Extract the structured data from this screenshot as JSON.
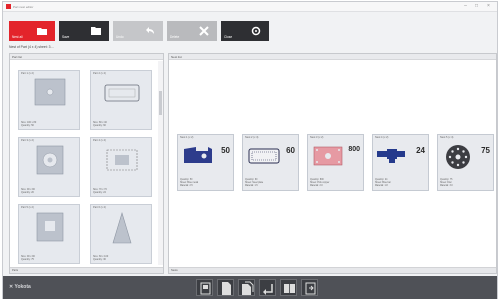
{
  "window": {
    "title": "Part nest editor"
  },
  "toolbar": {
    "buttons": [
      {
        "label": "Nest all",
        "icon": "folder-open-icon",
        "color": "#e3242b"
      },
      {
        "label": "Save",
        "icon": "folder-icon",
        "color": "#2e2f33"
      },
      {
        "label": "Undo",
        "icon": "undo-icon",
        "color": "#c5c6c9"
      },
      {
        "label": "Delete",
        "icon": "close-icon",
        "color": "#b9babd"
      },
      {
        "label": "Close",
        "icon": "settings-icon",
        "color": "#2e2f33"
      }
    ]
  },
  "path": "Nest of Part (4 x 4) sheet: 3 ...",
  "left_panel": {
    "title": "Part list",
    "thumbs": [
      {
        "title": "Part 1 (x 2)",
        "info": [
          "Size: 100 x 80",
          "Quantity: 50"
        ]
      },
      {
        "title": "Part 2 (x 4)",
        "info": [
          "Size: 80 x 40",
          "Quantity: 60"
        ]
      },
      {
        "title": "Part 3 (x 2)",
        "info": [
          "Size: 90 x 90",
          "Quantity: 20"
        ]
      },
      {
        "title": "Part 4 (x 4)",
        "info": [
          "Size: 70 x 70",
          "Quantity: 24"
        ]
      },
      {
        "title": "Part 5 (x 2)",
        "info": [
          "Size: 90 x 90",
          "Quantity: 75"
        ]
      },
      {
        "title": "Part 6 (x 4)",
        "info": [
          "Size: 60 x 100",
          "Quantity: 30"
        ]
      }
    ],
    "scroll_label": "Parts"
  },
  "right_panel": {
    "title": "Nest list",
    "cards": [
      {
        "title": "Nest 1 (x 2)",
        "count": "50",
        "info": [
          "Quantity: 50",
          "Sheet: Blue metal",
          "Material: 2.5"
        ],
        "shape_color": "#2d3c8c"
      },
      {
        "title": "Nest 2 (x 4)",
        "count": "60",
        "info": [
          "Quantity: 60",
          "Sheet: Steel plate",
          "Material: 1.5"
        ],
        "shape_color": "#2a2f52"
      },
      {
        "title": "Nest 3 (x 2)",
        "count": "800",
        "info": [
          "Quantity: 800",
          "Sheet: Pink copper",
          "Material: 2.0"
        ],
        "shape_color": "#e69aa3"
      },
      {
        "title": "Nest 4 (x 2)",
        "count": "24",
        "info": [
          "Quantity: 24",
          "Sheet: Blue bar",
          "Material: 1.8"
        ],
        "shape_color": "#253a8c"
      },
      {
        "title": "Nest 5 (x 4)",
        "count": "75",
        "info": [
          "Quantity: 75",
          "Sheet: Disc",
          "Material: 3.0"
        ],
        "shape_color": "#3c3d42"
      }
    ],
    "scroll_label": "Nests"
  },
  "bottom": {
    "brand": "Yokota",
    "buttons": [
      "pages-icon",
      "document-icon",
      "document-stack-icon",
      "undo-arrow-icon",
      "book-icon",
      "exit-icon"
    ]
  }
}
